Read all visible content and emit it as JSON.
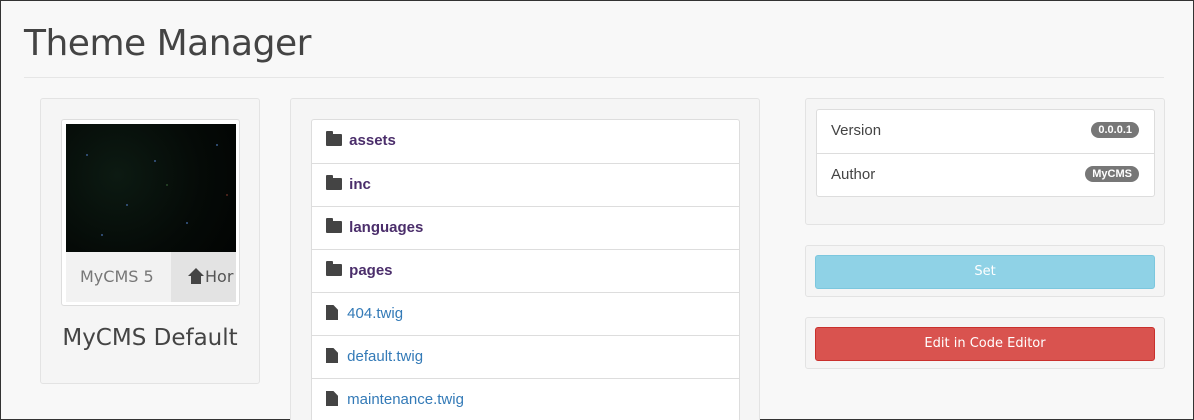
{
  "page": {
    "title": "Theme Manager"
  },
  "preview": {
    "thumbnail": {
      "brand": "MyCMS 5",
      "nav_home": "Hor",
      "home_icon": "home-icon"
    },
    "theme_name": "MyCMS Default"
  },
  "files": {
    "items": [
      {
        "type": "folder",
        "name": "assets",
        "icon": "folder-icon"
      },
      {
        "type": "folder",
        "name": "inc",
        "icon": "folder-icon"
      },
      {
        "type": "folder",
        "name": "languages",
        "icon": "folder-icon"
      },
      {
        "type": "folder",
        "name": "pages",
        "icon": "folder-icon"
      },
      {
        "type": "file",
        "name": "404.twig",
        "icon": "file-icon"
      },
      {
        "type": "file",
        "name": "default.twig",
        "icon": "file-icon"
      },
      {
        "type": "file",
        "name": "maintenance.twig",
        "icon": "file-icon"
      }
    ]
  },
  "info": {
    "version": {
      "label": "Version",
      "value": "0.0.0.1"
    },
    "author": {
      "label": "Author",
      "value": "MyCMS"
    }
  },
  "actions": {
    "set_label": "Set",
    "edit_label": "Edit in Code Editor"
  },
  "colors": {
    "folder_link": "#4b2e6b",
    "file_link": "#337ab7",
    "set_button": "#8fd2e6",
    "edit_button": "#d9534f",
    "badge": "#777777"
  }
}
